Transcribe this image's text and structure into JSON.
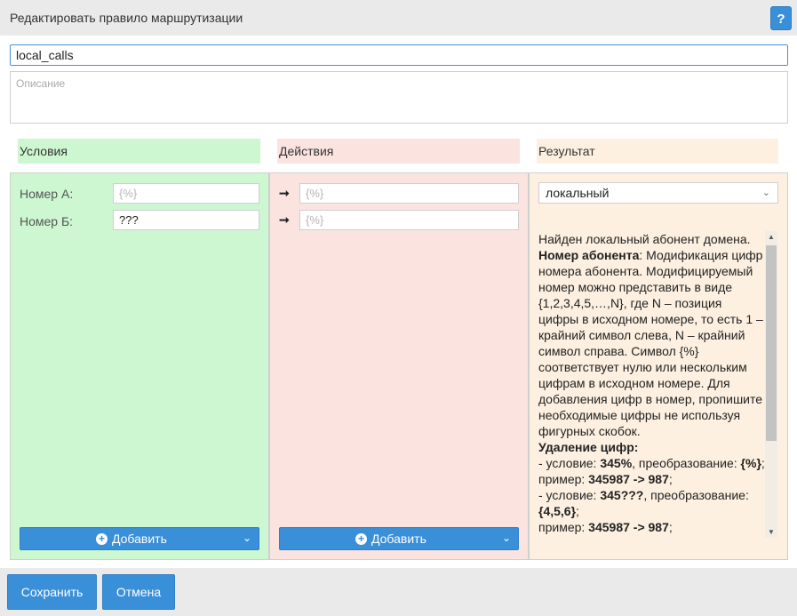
{
  "window": {
    "title": "Редактировать правило маршрутизации",
    "help_label": "?"
  },
  "rule": {
    "name_value": "local_calls",
    "description_placeholder": "Описание"
  },
  "columns": {
    "conditions": "Условия",
    "actions": "Действия",
    "result": "Результат"
  },
  "conditions": {
    "number_a_label": "Номер А:",
    "number_a_placeholder": "{%}",
    "number_b_label": "Номер Б:",
    "number_b_value": "???",
    "add_label": "Добавить"
  },
  "actions": {
    "arrow": "➞",
    "number_a_placeholder": "{%}",
    "number_b_placeholder": "{%}",
    "add_label": "Добавить"
  },
  "result": {
    "selected": "локальный",
    "help": [
      {
        "t": "Найден локальный абонент домена."
      },
      {
        "b": "Номер абонента",
        "t": ": Модификация цифр номера абонента. Модифицируемый номер можно представить в виде {1,2,3,4,5,…,N}, где N – позиция цифры в исходном номере, то есть 1 – крайний символ слева, N – крайний символ справа. Символ {%} соответствует нулю или нескольким цифрам в исходном номере. Для добавления цифр в номер, пропишите необходимые цифры не используя фигурных скобок."
      },
      {
        "b": "Удаление цифр:"
      },
      {
        "t": "- условие: ",
        "b2": "345%",
        "t2": ", преобразование: ",
        "b3": "{%}",
        "t3": ";"
      },
      {
        "t": "пример: ",
        "b2": "345987 -> 987",
        "t2": ";"
      },
      {
        "t": "- условие: ",
        "b2": "345???",
        "t2": ", преобразование: ",
        "b3": "{4,5,6}",
        "t3": ";"
      },
      {
        "t": "пример: ",
        "b2": "345987 -> 987",
        "t2": ";"
      }
    ]
  },
  "footer": {
    "save_label": "Сохранить",
    "cancel_label": "Отмена"
  },
  "colors": {
    "accent": "#3a8fd9",
    "conditions_bg": "#ccf7d1",
    "actions_bg": "#fbe3e0",
    "result_bg": "#fdf0e0"
  },
  "icons": {
    "add": "plus-circle-icon",
    "dropdown": "chevron-down-icon",
    "help": "question-icon"
  }
}
